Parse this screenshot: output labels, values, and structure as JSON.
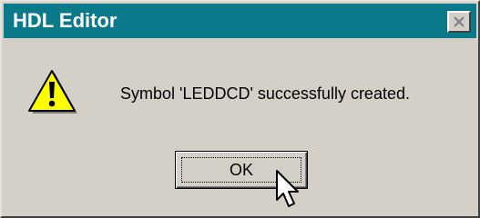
{
  "window": {
    "title": "HDL Editor",
    "titlebar_color": "#0a7a8a",
    "background_color": "#d4d0c8"
  },
  "titlebar": {
    "close_icon": "close-icon"
  },
  "dialog": {
    "icon": "warning-icon",
    "message": "Symbol 'LEDDCD' successfully created.",
    "ok_label": "OK"
  },
  "cursor": {
    "icon": "mouse-pointer-icon"
  }
}
